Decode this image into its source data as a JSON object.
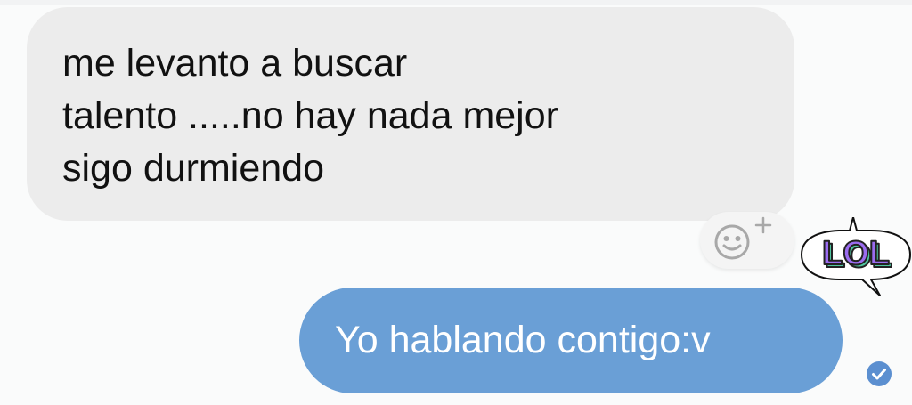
{
  "chat": {
    "incoming": {
      "lines": [
        "me levanto a buscar",
        "talento .....no hay nada mejor",
        "sigo durmiendo"
      ]
    },
    "outgoing": {
      "text": "Yo hablando contigo:v",
      "status_icon": "read-check-icon"
    },
    "reaction": {
      "icon": "smiley-plus-icon"
    },
    "sticker": {
      "text": "LOL"
    }
  },
  "colors": {
    "background": "#fafbfb",
    "incoming_bubble": "#ececec",
    "outgoing_bubble": "#6a9fd6",
    "outgoing_text": "#ffffff",
    "sticker_fill": "#9b6cf0",
    "sticker_shadow": "#4fc7a0",
    "read_check": "#5b8fd0"
  }
}
